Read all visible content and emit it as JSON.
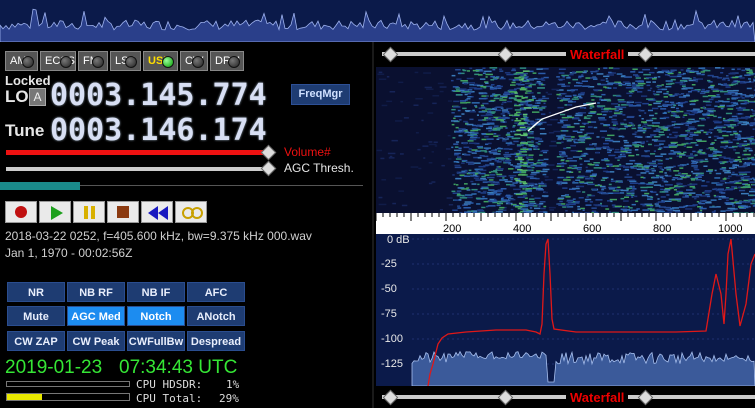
{
  "modes": [
    {
      "label": "AM",
      "active": false
    },
    {
      "label": "ECSS",
      "active": false
    },
    {
      "label": "FM",
      "active": false
    },
    {
      "label": "LSB",
      "active": false
    },
    {
      "label": "USB",
      "active": true
    },
    {
      "label": "CW",
      "active": false
    },
    {
      "label": "DRM",
      "active": false
    }
  ],
  "lo": {
    "locked_label": "Locked",
    "label": "LO",
    "badge": "A",
    "value": "0003.145.774"
  },
  "freqmgr_label": "FreqMgr",
  "tune": {
    "label": "Tune",
    "value": "0003.146.174"
  },
  "volume_label": "Volume#",
  "agc_label": "AGC Thresh.",
  "file_info": "2018-03-22 0252, f=405.600 kHz, bw=9.375 kHz 000.wav",
  "file_time": "Jan 1, 1970 - 00:02:56Z",
  "dsp_buttons": [
    [
      {
        "label": "NR",
        "on": false
      },
      {
        "label": "NB RF",
        "on": false
      },
      {
        "label": "NB IF",
        "on": false
      },
      {
        "label": "AFC",
        "on": false
      }
    ],
    [
      {
        "label": "Mute",
        "on": false
      },
      {
        "label": "AGC Med",
        "on": true
      },
      {
        "label": "Notch",
        "on": true
      },
      {
        "label": "ANotch",
        "on": false
      }
    ],
    [
      {
        "label": "CW ZAP",
        "on": false
      },
      {
        "label": "CW Peak",
        "on": false
      },
      {
        "label": "CWFullBw",
        "on": false
      },
      {
        "label": "Despread",
        "on": false
      }
    ]
  ],
  "clock": {
    "date": "2019-01-23",
    "time": "07:34:43 UTC"
  },
  "cpu": {
    "hdsdr_label": "CPU HDSDR:",
    "hdsdr_value": "1%",
    "total_label": "CPU Total:",
    "total_value": "29%",
    "total_fraction": 0.29
  },
  "waterfall_label": "Waterfall",
  "freq_axis": [
    "200",
    "400",
    "600",
    "800",
    "1000"
  ],
  "db_axis": [
    "0 dB",
    "-25",
    "-50",
    "-75",
    "-100",
    "-125"
  ],
  "colors": {
    "accent": "#e11",
    "active_mode": "#ffdf00",
    "dsp_on": "#1c8cf0",
    "dsp_off": "#1e3c72",
    "clock": "#35e635"
  }
}
